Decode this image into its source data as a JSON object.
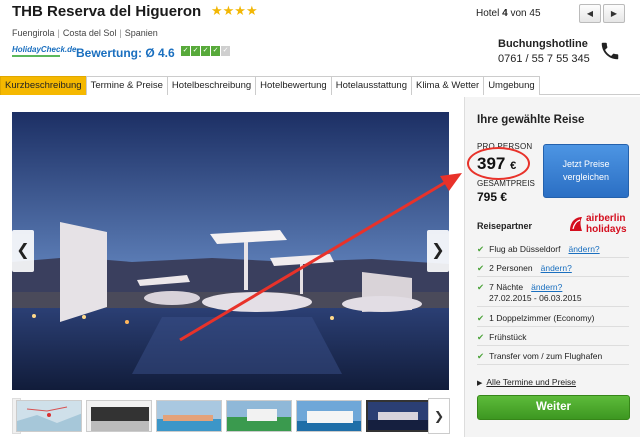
{
  "header": {
    "hotel_name": "THB Reserva del Higueron",
    "stars": "★★★★",
    "location": [
      "Fuengirola",
      "Costa del Sol",
      "Spanien"
    ],
    "rating_source": "HolidayCheck.de",
    "rating_label": "Bewertung:",
    "rating_value": "Ø 4.6",
    "rating_boxes": [
      "5",
      "5",
      "5",
      "5",
      "5"
    ],
    "hotel_count_prefix": "Hotel",
    "hotel_count_current": "4",
    "hotel_count_suffix": "von 45",
    "hotline_label": "Buchungshotline",
    "hotline_number": "0761 / 55 7 55 345"
  },
  "tabs": [
    {
      "label": "Kurzbeschreibung",
      "active": true
    },
    {
      "label": "Termine & Preise",
      "active": false
    },
    {
      "label": "Hotelbeschreibung",
      "active": false
    },
    {
      "label": "Hotelbewertung",
      "active": false
    },
    {
      "label": "Hotelausstattung",
      "active": false
    },
    {
      "label": "Klima & Wetter",
      "active": false
    },
    {
      "label": "Umgebung",
      "active": false
    }
  ],
  "panel": {
    "title": "Ihre gewählte Reise",
    "per_person_label": "PRO PERSON",
    "price": "397",
    "currency": "€",
    "total_label": "GESAMTPREIS",
    "total": "795 €",
    "cta": "Jetzt Preise vergleichen",
    "partner_label": "Reisepartner",
    "partner_name_1": "airberlin",
    "partner_name_2": "holidays",
    "features": [
      {
        "text": "Flug ab Düsseldorf",
        "change": "ändern?"
      },
      {
        "text": "2 Personen",
        "change": "ändern?"
      },
      {
        "text": "7 Nächte",
        "change": "ändern?",
        "sub": "27.02.2015 - 06.03.2015"
      },
      {
        "text": "1 Doppelzimmer (Economy)"
      },
      {
        "text": "Frühstück"
      },
      {
        "text": "Transfer vom / zum Flughafen"
      }
    ],
    "all_dates_link": "Alle Termine und Preise",
    "next_button": "Weiter"
  },
  "colors": {
    "tab_active": "#f5b800",
    "cta_blue": "#2b6fc4",
    "next_green": "#3d9721",
    "annotation_red": "#e8322a",
    "check_green": "#4ca33a"
  },
  "icons": [
    "phone-icon",
    "chevron-left-icon",
    "chevron-right-icon",
    "check-icon",
    "triangle-right-icon"
  ]
}
